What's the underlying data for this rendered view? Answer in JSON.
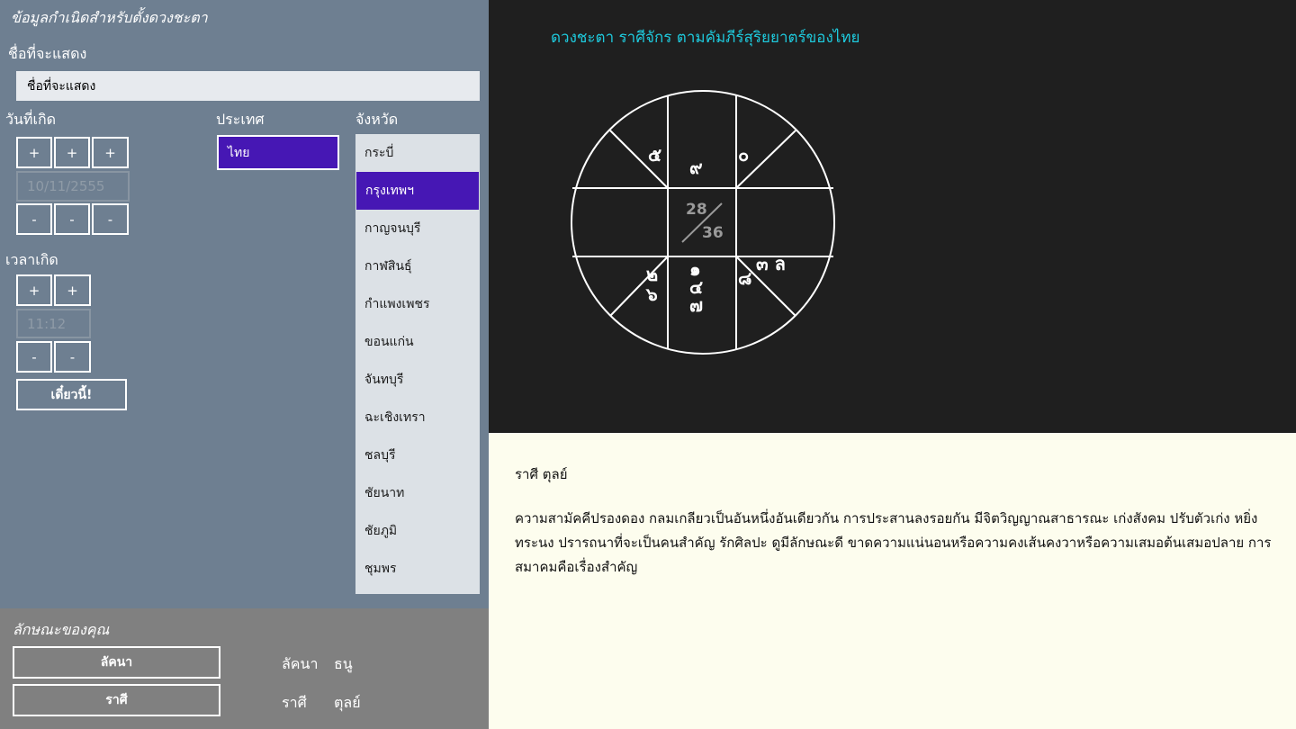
{
  "form": {
    "title": "ข้อมูลกำเนิดสำหรับตั้งดวงชะตา",
    "name_label": "ชื่อที่จะแสดง",
    "name_value": "ชื่อที่จะแสดง",
    "birthdate_label": "วันที่เกิด",
    "birthdate_value": "10/11/2555",
    "country_label": "ประเทศ",
    "country_selected": "ไทย",
    "province_label": "จังหวัด",
    "provinces": [
      "กระบี่",
      "กรุงเทพฯ",
      "กาญจนบุรี",
      "กาฬสินธุ์",
      "กำแพงเพชร",
      "ขอนแก่น",
      "จันทบุรี",
      "ฉะเชิงเทรา",
      "ชลบุรี",
      "ชัยนาท",
      "ชัยภูมิ",
      "ชุมพร"
    ],
    "province_selected_index": 1,
    "birthtime_label": "เวลาเกิด",
    "birthtime_value": "11:12",
    "plus_label": "+",
    "minus_label": "-",
    "now_button": "เดี๋ยวนี้!"
  },
  "traits": {
    "title": "ลักษณะของคุณ",
    "lagna_button": "ลัคนา",
    "rasi_button": "ราศี",
    "lagna_label": "ลัคนา",
    "lagna_value": "ธนู",
    "rasi_label": "ราศี",
    "rasi_value": "ตุลย์"
  },
  "chart": {
    "title": "ดวงชะตา ราศีจักร ตามคัมภีร์สุริยยาตร์ของไทย",
    "center_top": "28",
    "center_bottom": "36",
    "house_labels": {
      "upper_left_diag": "๕",
      "top_center": "๙",
      "upper_right_diag": "๐",
      "lower_left_diag_1": "๒",
      "lower_left_diag_2": "๖",
      "bottom_center_1": "๑",
      "bottom_center_2": "๔",
      "bottom_center_3": "๗",
      "lower_right_diag": "๘",
      "lower_right_top": "๓ ล"
    },
    "line_color": "#ffffff",
    "title_color": "#1ec9dc"
  },
  "description": {
    "rasi_heading": "ราศี ตุลย์",
    "text": "ความสามัคคีปรองดอง กลมเกลียวเป็นอันหนึ่งอันเดียวกัน การประสานลงรอยกัน มีจิตวิญญาณสาธารณะ เก่งสังคม ปรับตัวเก่ง หยิ่ง ทระนง ปรารถนาที่จะเป็นคนสำคัญ รักศิลปะ ดูมีลักษณะดี ขาดความแน่นอนหรือความคงเส้นคงวาหรือความเสมอต้นเสมอปลาย การสมาคมคือเรื่องสำคัญ"
  },
  "colors": {
    "left_panel": "#6e7f91",
    "selection": "#4617b4",
    "description_bg": "#fdfdee"
  }
}
